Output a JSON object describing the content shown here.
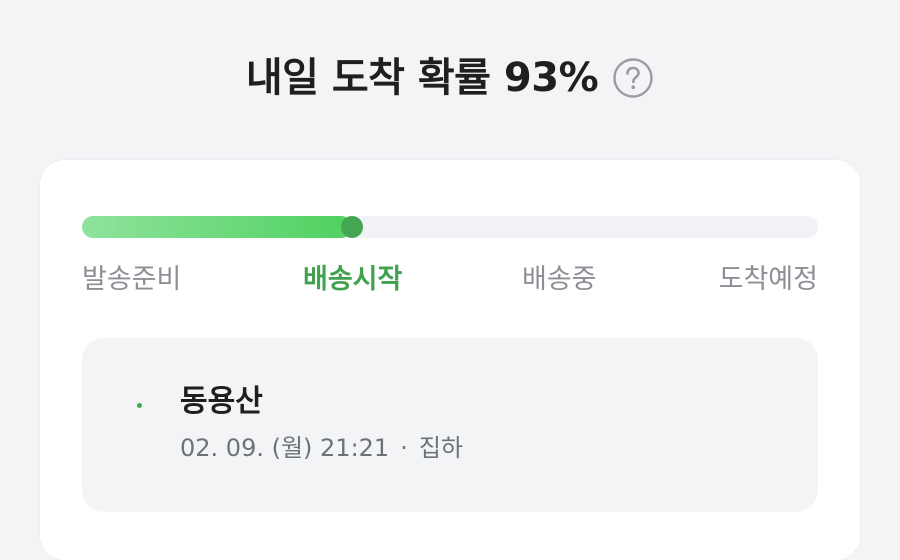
{
  "header": {
    "title": "내일 도착 확률 93%",
    "help_icon": "question-circle-icon"
  },
  "progress": {
    "value": 0.367,
    "fill_color_start": "#8fe39c",
    "fill_color_end": "#4fd160",
    "knob_color": "#44a552",
    "track_color": "#f0f2f5"
  },
  "steps": [
    {
      "label": "발송준비",
      "active": false
    },
    {
      "label": "배송시작",
      "active": true
    },
    {
      "label": "배송중",
      "active": false
    },
    {
      "label": "도착예정",
      "active": false
    }
  ],
  "tracking": {
    "location": "동용산",
    "datetime": "02. 09. (월) 21:21",
    "separator": "·",
    "status": "집하",
    "dot_color": "#3fae4e"
  }
}
